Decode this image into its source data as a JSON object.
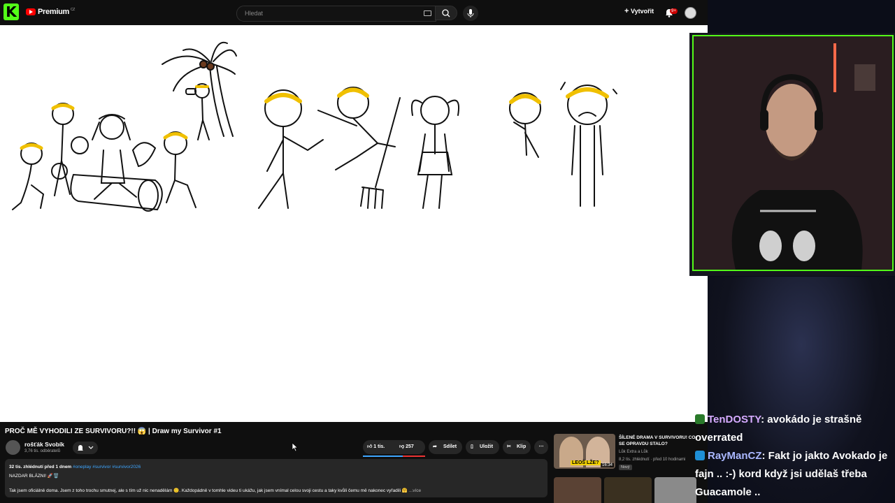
{
  "topbar": {
    "logo_letter": "K",
    "brand": "Premium",
    "brand_region": "CZ",
    "search_placeholder": "Hledat",
    "create_label": "Vytvořit",
    "notif_count": "9+"
  },
  "video": {
    "title": "PROČ MĚ VYHODILI ZE SURVIVORU?!! 😱 | Draw my Survivor #1",
    "channel_name": "rošťák Svobík",
    "channel_subs": "3,76 tis. odběratelů",
    "likes": "1 tis.",
    "dislikes": "257",
    "share_label": "Sdílet",
    "save_label": "Uložit",
    "clip_label": "Klip",
    "like_ratio": 0.64
  },
  "description": {
    "meta": "32 tis. zhlédnutí  před 1 dnem",
    "tags": "#oneplay #survivor #survivor2026",
    "line1": "NAZDAR BLÁZNI! 🚀🗑️",
    "line2": "Tak jsem oficiálně doma. Jsem z toho trochu smutnej, ale s tím už nic nenadělám 🙂. Každopádně v tomhle videu ti ukážu, jak jsem vnímal celou svoji cestu a taky kvůli čemu mě nakonec vyřadili 🤗",
    "more": " ...více"
  },
  "recommended": {
    "title": "ŠÍLENÉ DRAMA V SURVIVORU! CO SE OPRAVDU STALO?",
    "channel": "Lůk Extra a Lůk",
    "views": "8,2 tis. zhlédnutí · před 10 hodinami",
    "badge": "Nový",
    "duration": "16:34",
    "thumb_text": "LEOŠ LŽE?"
  },
  "chat": [
    {
      "user": "TenDOSTY",
      "text": ": avokádo je strašně overrated"
    },
    {
      "user": "RayManCZ",
      "text": ": Fakt jo jakto Avokado je fajn .. :-) kord když jsi udělaš třeba Guacamole .."
    }
  ],
  "colors": {
    "kick_green": "#53fc18",
    "yt_red": "#ff0000",
    "link_blue": "#3ea6ff"
  }
}
